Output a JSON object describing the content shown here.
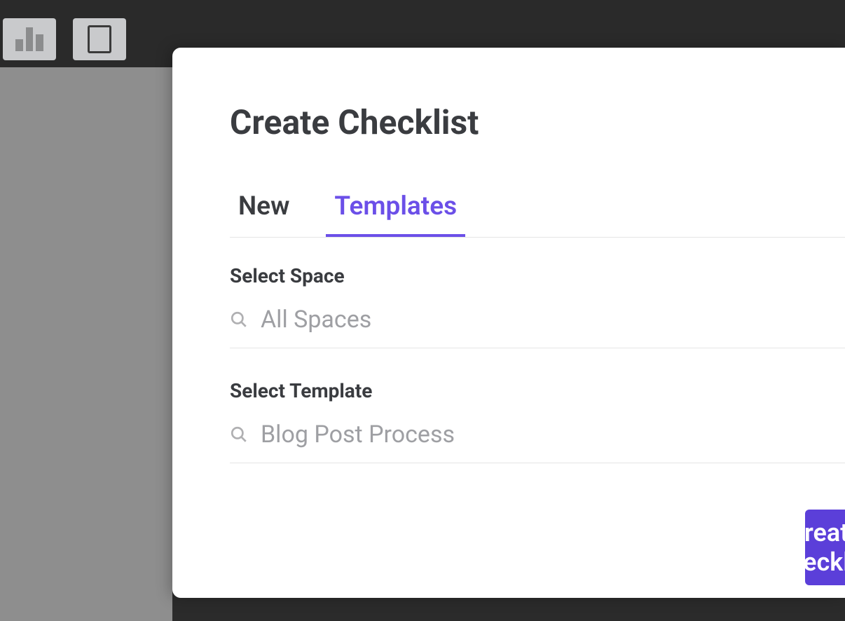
{
  "modal": {
    "title": "Create Checklist",
    "tabs": {
      "new": "New",
      "templates": "Templates"
    },
    "space_section": {
      "label": "Select Space",
      "placeholder": "All Spaces"
    },
    "template_section": {
      "label": "Select Template",
      "placeholder": "Blog Post Process"
    },
    "primary_action": "Create Checklist"
  },
  "colors": {
    "accent": "#6b4fe8",
    "button": "#5b3fd9"
  }
}
